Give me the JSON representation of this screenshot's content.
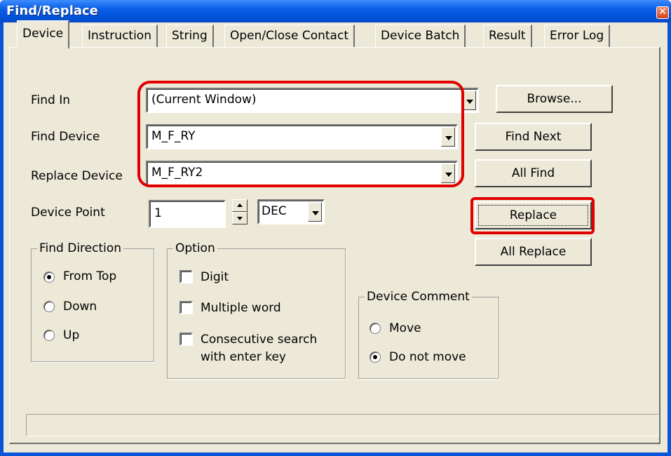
{
  "window": {
    "title": "Find/Replace",
    "close_glyph": "✕"
  },
  "tabs": [
    {
      "label": "Device",
      "active": true
    },
    {
      "label": "Instruction"
    },
    {
      "label": "String"
    },
    {
      "label": "Open/Close Contact"
    },
    {
      "label": "Device Batch"
    },
    {
      "label": "Result"
    },
    {
      "label": "Error Log"
    }
  ],
  "fields": {
    "find_in_label": "Find In",
    "find_in_value": "(Current Window)",
    "find_device_label": "Find Device",
    "find_device_value": "M_F_RY",
    "replace_device_label": "Replace Device",
    "replace_device_value": "M_F_RY2",
    "device_point_label": "Device Point",
    "device_point_value": "1",
    "radix_value": "DEC"
  },
  "buttons": {
    "browse": "Browse...",
    "find_next": "Find Next",
    "all_find": "All Find",
    "replace": "Replace",
    "all_replace": "All Replace"
  },
  "find_direction": {
    "title": "Find Direction",
    "options": [
      "From Top",
      "Down",
      "Up"
    ],
    "selected": "From Top"
  },
  "option": {
    "title": "Option",
    "checkboxes": [
      "Digit",
      "Multiple word",
      "Consecutive search",
      "with enter key"
    ]
  },
  "device_comment": {
    "title": "Device Comment",
    "options": [
      "Move",
      "Do not move"
    ],
    "selected": "Do not move"
  },
  "colors": {
    "highlight": "#e00000",
    "title_bar": "#0a5ee6",
    "dialog_bg": "#ece9d8"
  }
}
